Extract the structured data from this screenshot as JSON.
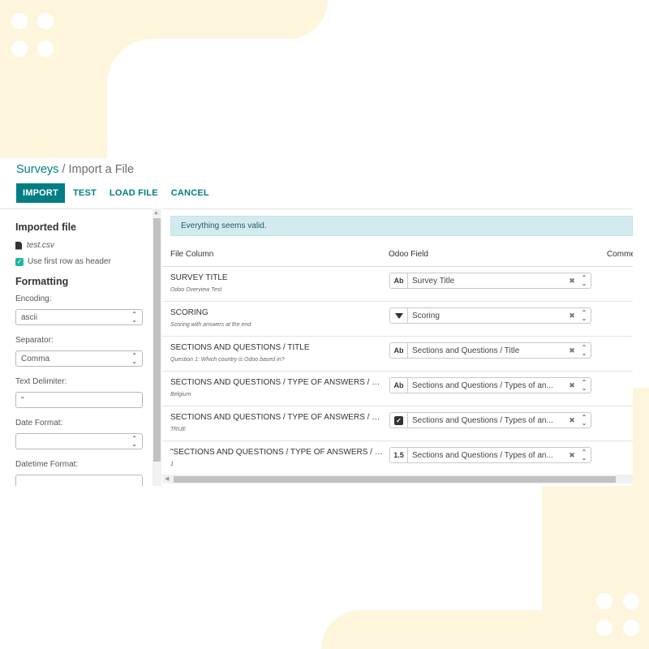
{
  "breadcrumb": {
    "parent": "Surveys",
    "separator": " / ",
    "current": "Import a File"
  },
  "toolbar": {
    "import_label": "IMPORT",
    "test_label": "TEST",
    "load_file_label": "LOAD FILE",
    "cancel_label": "CANCEL"
  },
  "sidebar": {
    "imported_file_title": "Imported file",
    "file_name": "test.csv",
    "file_icon": "file-icon",
    "first_row_header_label": "Use first row as header",
    "first_row_header_checked": true,
    "formatting_title": "Formatting",
    "encoding_label": "Encoding:",
    "encoding_value": "ascii",
    "separator_label": "Separator:",
    "separator_value": "Comma",
    "text_delimiter_label": "Text Delimiter:",
    "text_delimiter_value": "\"",
    "date_format_label": "Date Format:",
    "date_format_value": "",
    "datetime_format_label": "Datetime Format:",
    "datetime_format_value": ""
  },
  "main": {
    "alert_text": "Everything seems valid.",
    "columns": {
      "file_column": "File Column",
      "odoo_field": "Odoo Field",
      "comments": "Comme"
    },
    "rows": [
      {
        "name": "SURVEY TITLE",
        "sample": "Odoo Overview Test",
        "type_icon": "Ab",
        "field": "Survey Title"
      },
      {
        "name": "SCORING",
        "sample": "Scoring with answers at the end",
        "type_icon": "triangle-down-icon",
        "field": "Scoring"
      },
      {
        "name": "SECTIONS AND QUESTIONS / TITLE",
        "sample": "Question 1: Which country is Odoo based in?",
        "type_icon": "Ab",
        "field": "Sections and Questions / Title"
      },
      {
        "name": "SECTIONS AND QUESTIONS / TYPE OF ANSWERS / SUG...",
        "sample": "Belgium",
        "type_icon": "Ab",
        "field": "Sections and Questions / Types of an..."
      },
      {
        "name": "SECTIONS AND QUESTIONS / TYPE OF ANSWERS / COR...",
        "sample": "TRUE",
        "type_icon": "checkbox-icon",
        "field": "Sections and Questions / Types of an..."
      },
      {
        "name": "\"SECTIONS AND QUESTIONS / TYPE OF ANSWERS / SCO...",
        "sample": "1",
        "type_icon": "1.5",
        "field": "Sections and Questions / Types of an..."
      }
    ]
  },
  "colors": {
    "accent": "#017e84",
    "alert_bg": "#d3ebef",
    "checkbox": "#21b799",
    "background_shape": "#fdf6dd"
  }
}
